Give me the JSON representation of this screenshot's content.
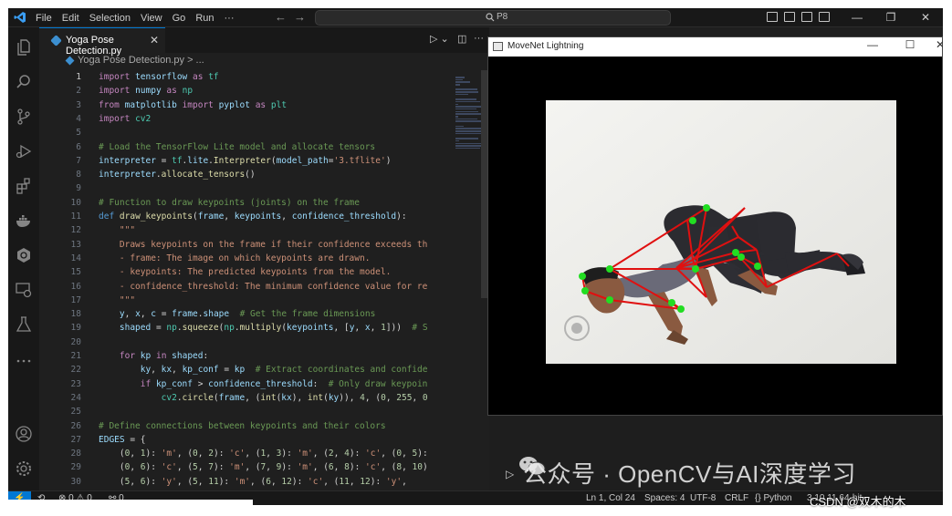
{
  "menu": [
    "File",
    "Edit",
    "Selection",
    "View",
    "Go",
    "Run",
    "···"
  ],
  "command_center": "P8",
  "editor": {
    "tab_label": "Yoga Pose Detection.py",
    "breadcrumb": "Yoga Pose Detection.py > ..."
  },
  "code_lines": [
    {
      "n": "1",
      "t": "import tensorflow as tf"
    },
    {
      "n": "2",
      "t": "import numpy as np"
    },
    {
      "n": "3",
      "t": "from matplotlib import pyplot as plt"
    },
    {
      "n": "4",
      "t": "import cv2"
    },
    {
      "n": "5",
      "t": ""
    },
    {
      "n": "6",
      "t": "# Load the TensorFlow Lite model and allocate tensors"
    },
    {
      "n": "7",
      "t": "interpreter = tf.lite.Interpreter(model_path='3.tflite')"
    },
    {
      "n": "8",
      "t": "interpreter.allocate_tensors()"
    },
    {
      "n": "9",
      "t": ""
    },
    {
      "n": "10",
      "t": "# Function to draw keypoints (joints) on the frame"
    },
    {
      "n": "11",
      "t": "def draw_keypoints(frame, keypoints, confidence_threshold):"
    },
    {
      "n": "12",
      "t": "    \"\"\""
    },
    {
      "n": "13",
      "t": "    Draws keypoints on the frame if their confidence exceeds th"
    },
    {
      "n": "14",
      "t": "    - frame: The image on which keypoints are drawn."
    },
    {
      "n": "15",
      "t": "    - keypoints: The predicted keypoints from the model."
    },
    {
      "n": "16",
      "t": "    - confidence_threshold: The minimum confidence value for re"
    },
    {
      "n": "17",
      "t": "    \"\"\""
    },
    {
      "n": "18",
      "t": "    y, x, c = frame.shape  # Get the frame dimensions"
    },
    {
      "n": "19",
      "t": "    shaped = np.squeeze(np.multiply(keypoints, [y, x, 1]))  # S"
    },
    {
      "n": "20",
      "t": ""
    },
    {
      "n": "21",
      "t": "    for kp in shaped:"
    },
    {
      "n": "22",
      "t": "        ky, kx, kp_conf = kp  # Extract coordinates and confide"
    },
    {
      "n": "23",
      "t": "        if kp_conf > confidence_threshold:  # Only draw keypoin"
    },
    {
      "n": "24",
      "t": "            cv2.circle(frame, (int(kx), int(ky)), 4, (0, 255, 0"
    },
    {
      "n": "25",
      "t": ""
    },
    {
      "n": "26",
      "t": "# Define connections between keypoints and their colors"
    },
    {
      "n": "27",
      "t": "EDGES = {"
    },
    {
      "n": "28",
      "t": "    (0, 1): 'm', (0, 2): 'c', (1, 3): 'm', (2, 4): 'c', (0, 5):"
    },
    {
      "n": "29",
      "t": "    (0, 6): 'c', (5, 7): 'm', (7, 9): 'm', (6, 8): 'c', (8, 10)"
    },
    {
      "n": "30",
      "t": "    (5, 6): 'y', (5, 11): 'm', (6, 12): 'c', (11, 12): 'y',"
    }
  ],
  "movenet_window": {
    "title": "MoveNet Lightning"
  },
  "status": {
    "errors": "0",
    "warnings": "0",
    "ports": "0",
    "position": "Ln 1, Col 24",
    "spaces": "Spaces: 4",
    "encoding": "UTF-8",
    "eol": "CRLF",
    "language": "Python",
    "version": "3.10.11 64-bit"
  },
  "watermarks": {
    "wechat": "公众号 · OpenCV与AI深度学习",
    "csdn": "CSDN @双木的木"
  },
  "colors": {
    "accent": "#0078d4",
    "keypoint": "#22dd22",
    "skeleton": "#e01010"
  }
}
